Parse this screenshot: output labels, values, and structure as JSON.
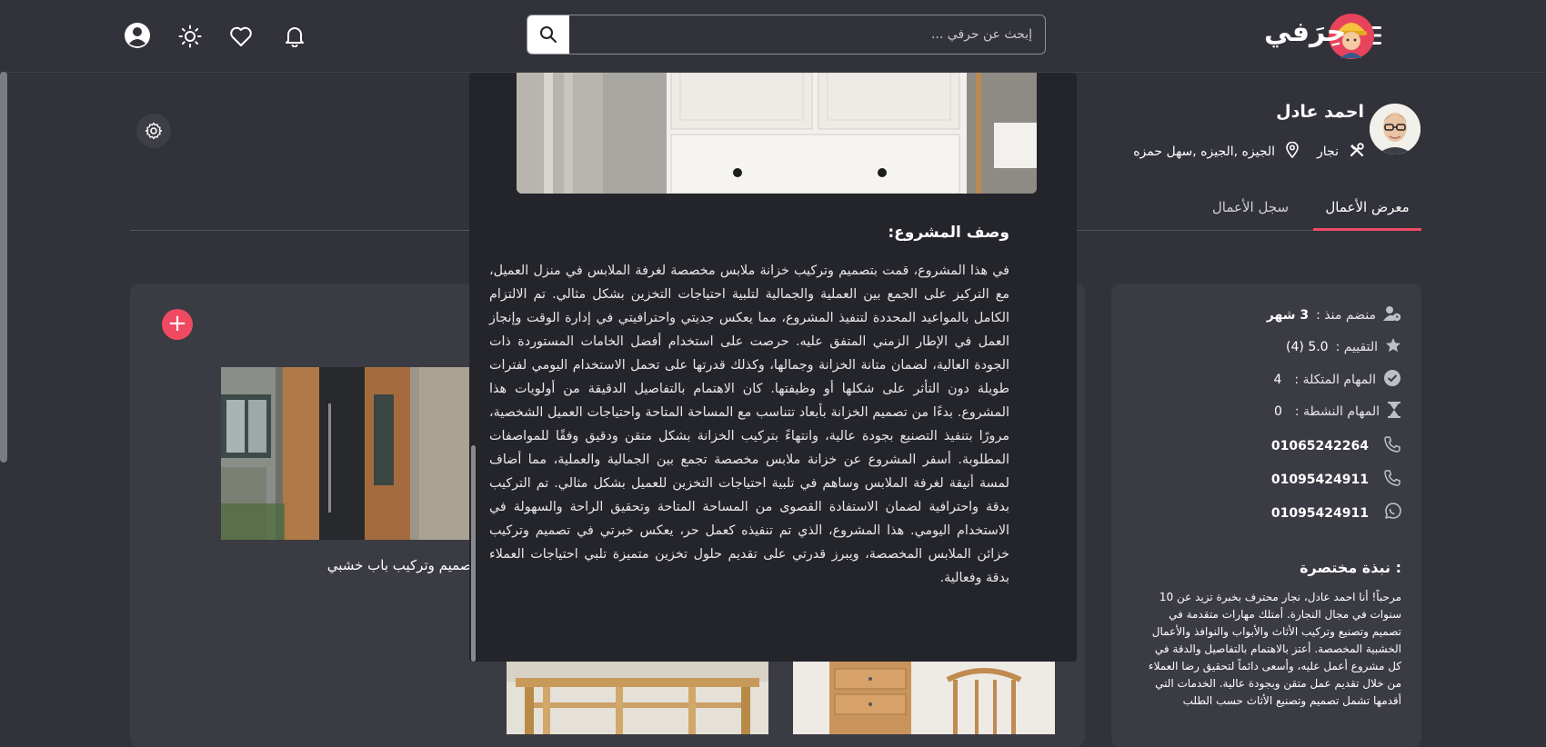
{
  "header": {
    "logo_text": "حِرَفي",
    "search_placeholder": "إبحث عن حرفي ..."
  },
  "profile": {
    "name": "احمد عادل",
    "profession": "نجار",
    "location": "الجيزه ,الجيزه ,سهل حمزه"
  },
  "tabs": {
    "gallery": "معرض الأعمال",
    "history": "سجل الأعمال"
  },
  "stats": {
    "joined_label": "منضم منذ :",
    "joined_value": "3 شهر",
    "rating_label": "التقييم :",
    "rating_value": "5.0 (4)",
    "completed_label": "المهام المتكلة :",
    "completed_value": "4",
    "active_label": "المهام النشطة :",
    "active_value": "0",
    "phone1": "01065242264",
    "phone2": "01095424911",
    "whatsapp": "01095424911"
  },
  "bio": {
    "title": "نبذة مختصرة :",
    "text": "مرحباً! أنا احمد عادل، نجار محترف بخبرة تزيد عن 10 سنوات في مجال النجارة. أمتلك مهارات متقدمة في تصميم وتصنيع وتركيب الأثاث والأبواب والنوافذ والأعمال الخشبية المخصصة. أعتز بالاهتمام بالتفاصيل والدقة في كل مشروع أعمل عليه، وأسعى دائماً لتحقيق رضا العملاء من خلال تقديم عمل متقن وبجودة عالية. الخدمات التي أقدمها تشمل تصميم وتصنيع الأثاث حسب الطلب"
  },
  "works": {
    "item1_title": "تصميم وتركيب باب خشبي"
  },
  "modal": {
    "desc_title": "وصف المشروع:",
    "desc_text": "في هذا المشروع، قمت بتصميم وتركيب خزانة ملابس مخصصة لغرفة الملابس في منزل العميل، مع التركيز على الجمع بين العملية والجمالية لتلبية احتياجات التخزين بشكل مثالي. تم الالتزام الكامل بالمواعيد المحددة لتنفيذ المشروع، مما يعكس جديتي واحترافيتي في إدارة الوقت وإنجاز العمل في الإطار الزمني المتفق عليه. حرصت على استخدام أفضل الخامات المستوردة ذات الجودة العالية، لضمان متانة الخزانة وجمالها، وكذلك قدرتها على تحمل الاستخدام اليومي لفترات طويلة دون التأثر على شكلها أو وظيفتها. كان الاهتمام بالتفاصيل الدقيقة من أولويات هذا المشروع. بدءًا من تصميم الخزانة بأبعاد تتناسب مع المساحة المتاحة واحتياجات العميل الشخصية، مرورًا بتنفيذ التصنيع بجودة عالية، وانتهاءً بتركيب الخزانة بشكل متقن ودقيق وفقًا للمواصفات المطلوبة. أسفر المشروع عن خزانة ملابس مخصصة تجمع بين الجمالية والعملية، مما أضاف لمسة أنيقة لغرفة الملابس وساهم في تلبية احتياجات التخزين للعميل بشكل مثالي. تم التركيب بدقة واحترافية لضمان الاستفادة القصوى من المساحة المتاحة وتحقيق الراحة والسهولة في الاستخدام اليومي. هذا المشروع، الذي تم تنفيذه كعمل حر، يعكس خبرتي في تصميم وتركيب خزائن الملابس المخصصة، ويبرز قدرتي على تقديم حلول تخزين متميزة تلبي احتياجات العملاء بدقة وفعالية."
  },
  "colors": {
    "background": "#31323a",
    "card": "#3a3b43",
    "modal": "#24242b",
    "accent": "#ef4a62"
  },
  "icons": [
    "menu-icon",
    "logo-avatar-icon",
    "search-icon",
    "bell-icon",
    "heart-icon",
    "sun-icon",
    "user-icon",
    "settings-icon",
    "tools-icon",
    "location-icon",
    "user-clock-icon",
    "star-icon",
    "check-circle-icon",
    "hourglass-icon",
    "phone-icon",
    "whatsapp-icon",
    "plus-icon"
  ]
}
